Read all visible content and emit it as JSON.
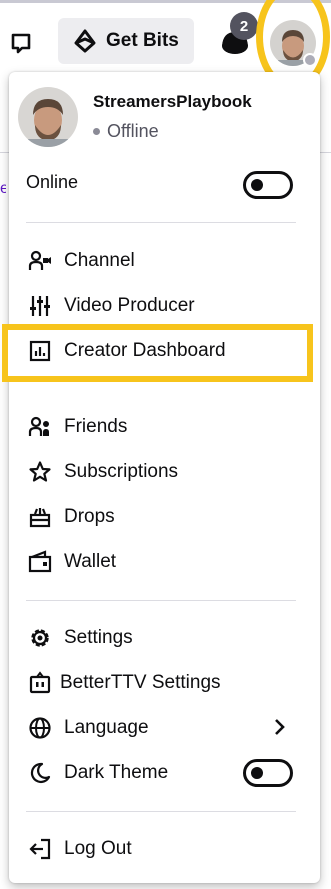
{
  "topbar": {
    "get_bits_label": "Get Bits",
    "notification_count": "2"
  },
  "user": {
    "name": "StreamersPlaybook",
    "status": "Offline"
  },
  "online_toggle": {
    "label": "Online"
  },
  "menu": {
    "channel": "Channel",
    "video_producer": "Video Producer",
    "creator_dashboard": "Creator Dashboard",
    "friends": "Friends",
    "subscriptions": "Subscriptions",
    "drops": "Drops",
    "wallet": "Wallet",
    "settings": "Settings",
    "betterttv": "BetterTTV Settings",
    "language": "Language",
    "dark_theme": "Dark Theme",
    "log_out": "Log Out"
  },
  "colors": {
    "highlight": "#f7c41c",
    "text": "#0e0e10",
    "badge": "#53535f"
  },
  "icons": [
    "whisper-icon",
    "bits-icon",
    "crown-icon",
    "channel-icon",
    "video-producer-icon",
    "dashboard-icon",
    "friends-icon",
    "star-icon",
    "drops-icon",
    "wallet-icon",
    "gear-icon",
    "betterttv-icon",
    "globe-icon",
    "moon-icon",
    "logout-icon",
    "chevron-right-icon"
  ]
}
